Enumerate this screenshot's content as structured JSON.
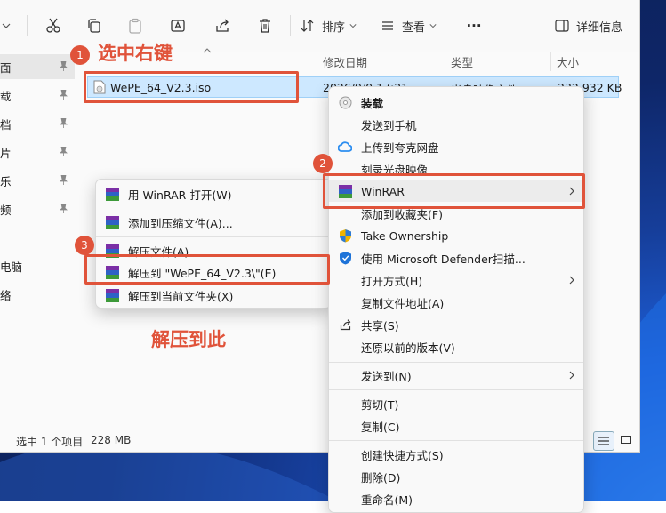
{
  "toolbar": {
    "sort_label": "排序",
    "view_label": "查看",
    "more_label": "···",
    "details_label": "详细信息"
  },
  "sidebar": {
    "items": [
      "面",
      "载",
      "档",
      "片",
      "乐",
      "频",
      "电脑",
      "络"
    ]
  },
  "columns": {
    "modified": "修改日期",
    "type": "类型",
    "size": "大小"
  },
  "file": {
    "name": "WePE_64_V2.3.iso",
    "modified": "2026/9/0 17:21",
    "type": "光盘映像文件",
    "size": "232,932 KB"
  },
  "status": {
    "selection": "选中 1 个项目",
    "size": "228 MB"
  },
  "context_menu": {
    "items": [
      {
        "label": "装载",
        "icon": "disc-icon"
      },
      {
        "label": "发送到手机",
        "icon": ""
      },
      {
        "label": "上传到夸克网盘",
        "icon": "cloud-icon"
      },
      {
        "label": "刻录光盘映像",
        "icon": ""
      },
      {
        "label": "WinRAR",
        "icon": "winrar-icon",
        "submenu": true
      },
      {
        "label": "添加到收藏夹(F)",
        "icon": ""
      },
      {
        "label": "Take Ownership",
        "icon": "shield-icon"
      },
      {
        "label": "使用 Microsoft Defender扫描...",
        "icon": "defender-icon"
      },
      {
        "label": "打开方式(H)",
        "icon": "",
        "submenu": true
      },
      {
        "label": "复制文件地址(A)",
        "icon": ""
      },
      {
        "label": "共享(S)",
        "icon": "share-icon"
      },
      {
        "label": "还原以前的版本(V)",
        "icon": ""
      },
      {
        "label": "发送到(N)",
        "icon": "",
        "submenu": true
      },
      {
        "label": "剪切(T)",
        "icon": ""
      },
      {
        "label": "复制(C)",
        "icon": ""
      },
      {
        "label": "创建快捷方式(S)",
        "icon": ""
      },
      {
        "label": "删除(D)",
        "icon": ""
      },
      {
        "label": "重命名(M)",
        "icon": ""
      }
    ]
  },
  "winrar_menu": {
    "items": [
      "用 WinRAR 打开(W)",
      "添加到压缩文件(A)...",
      "解压文件(A)...",
      "解压到 \"WePE_64_V2.3\\\"(E)",
      "解压到当前文件夹(X)"
    ]
  },
  "annotations": {
    "step1_text": "选中右键",
    "step3_text": "解压到此",
    "badge1": "1",
    "badge2": "2",
    "badge3": "3"
  },
  "colors": {
    "accent": "#e0533a",
    "selection": "#cde8ff"
  }
}
